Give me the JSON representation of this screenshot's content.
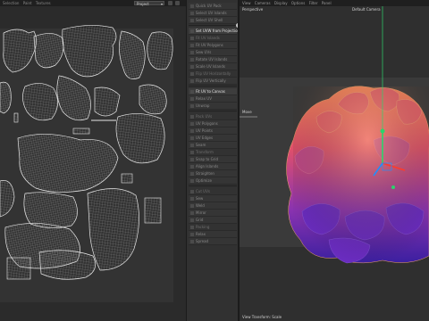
{
  "uv_editor": {
    "menu": [
      "Selection",
      "Paint",
      "Textures"
    ],
    "project_dropdown": "Project"
  },
  "tool_panel": {
    "items": [
      {
        "label": "Quick UV Pack"
      },
      {
        "label": "Select UV Islands"
      },
      {
        "label": "Select UV Shell"
      },
      {
        "label": "Set UVW from Projection",
        "active": true
      },
      {
        "label": "Fit UV Islands"
      },
      {
        "label": "Fit UV Polygons"
      },
      {
        "label": "Sew UVs"
      },
      {
        "label": "Rotate UV Islands"
      },
      {
        "label": "Scale UV Islands"
      },
      {
        "label": "Flip UV Horizontally"
      },
      {
        "label": "Flip UV Vertically"
      },
      {
        "label": "Fit UV to Canvas",
        "active": true
      },
      {
        "label": "Relax UV"
      },
      {
        "label": "Unwrap"
      },
      {
        "label": "Pack UVs"
      },
      {
        "label": "UV Polygons"
      },
      {
        "label": "UV Points"
      },
      {
        "label": "UV Edges"
      },
      {
        "label": "Seam"
      },
      {
        "label": "Transform"
      },
      {
        "label": "Snap to Grid"
      },
      {
        "label": "Align Islands"
      },
      {
        "label": "Straighten"
      },
      {
        "label": "Optimize"
      },
      {
        "label": "Cut UVs"
      },
      {
        "label": "Sew"
      },
      {
        "label": "Weld"
      },
      {
        "label": "Mirror"
      },
      {
        "label": "Grid"
      },
      {
        "label": "Packing"
      },
      {
        "label": "Relax"
      },
      {
        "label": "Spread"
      }
    ]
  },
  "viewport": {
    "menu": [
      "View",
      "Cameras",
      "Display",
      "Options",
      "Filter",
      "Panel"
    ],
    "view_label": "Perspective",
    "camera_label": "Default Camera",
    "axis_label": "Move",
    "status_text": "View Transform: Scale"
  },
  "colors": {
    "accent_blue": "#1e8fff",
    "axis_green": "#2bd46c",
    "axis_red": "#ff3a2a",
    "mesh_top": "#f06a52",
    "mesh_bottom": "#4b2bb8"
  }
}
